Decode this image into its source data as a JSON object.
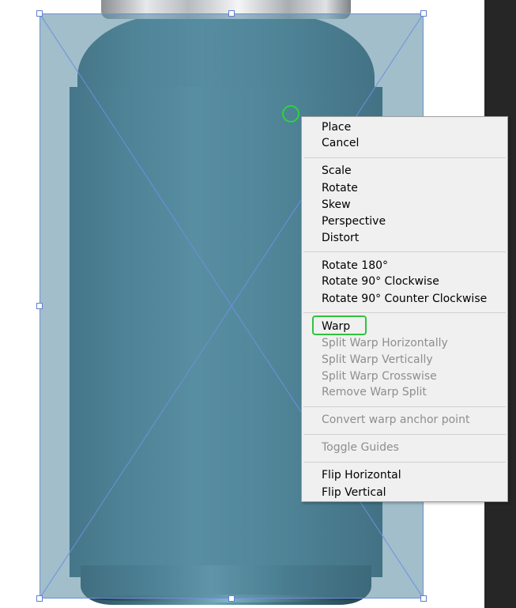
{
  "menu": {
    "items": [
      {
        "label": "Place",
        "enabled": true
      },
      {
        "label": "Cancel",
        "enabled": true
      },
      {
        "label": "Scale",
        "enabled": true
      },
      {
        "label": "Rotate",
        "enabled": true
      },
      {
        "label": "Skew",
        "enabled": true
      },
      {
        "label": "Perspective",
        "enabled": true
      },
      {
        "label": "Distort",
        "enabled": true
      },
      {
        "label": "Rotate 180°",
        "enabled": true
      },
      {
        "label": "Rotate 90° Clockwise",
        "enabled": true
      },
      {
        "label": "Rotate 90° Counter Clockwise",
        "enabled": true
      },
      {
        "label": "Warp",
        "enabled": true,
        "highlighted": true
      },
      {
        "label": "Split Warp Horizontally",
        "enabled": false
      },
      {
        "label": "Split Warp Vertically",
        "enabled": false
      },
      {
        "label": "Split Warp Crosswise",
        "enabled": false
      },
      {
        "label": "Remove Warp Split",
        "enabled": false
      },
      {
        "label": "Convert warp anchor point",
        "enabled": false
      },
      {
        "label": "Toggle Guides",
        "enabled": false
      },
      {
        "label": "Flip Horizontal",
        "enabled": true
      },
      {
        "label": "Flip Vertical",
        "enabled": true
      }
    ]
  },
  "colors": {
    "highlight_ring": "#2fc43c",
    "cursor_ring": "#2bd43a",
    "transform_overlay": "#54889e",
    "guide_lines": "#6d8fe0",
    "menu_background": "#f0f0f0",
    "right_panel": "#262626"
  },
  "icons": [
    "cursor-ring-icon"
  ]
}
